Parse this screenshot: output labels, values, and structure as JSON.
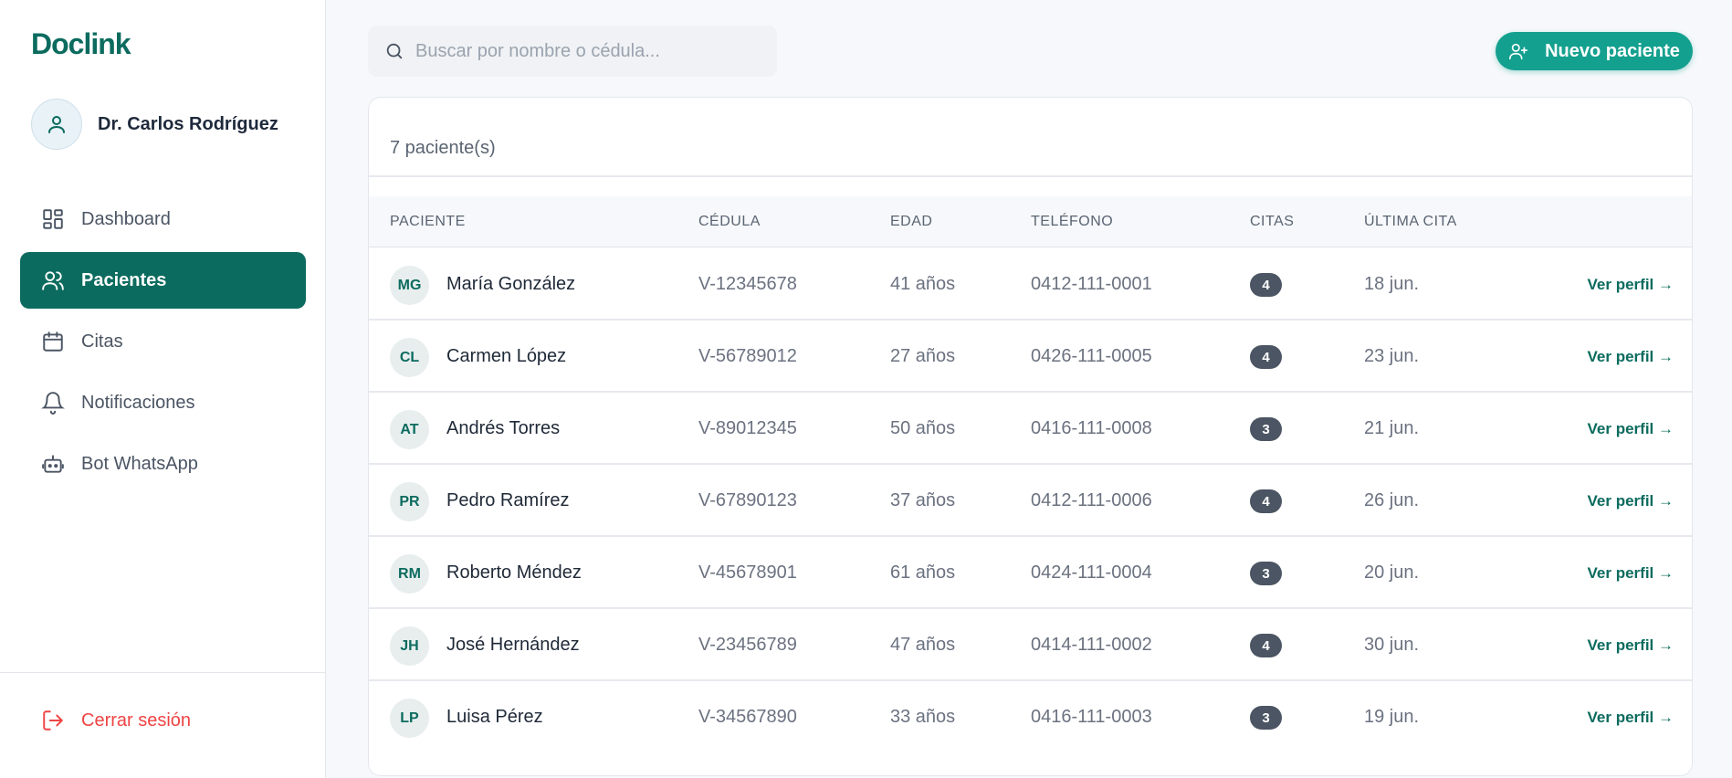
{
  "brand": {
    "name": "Doclink",
    "color": "#0b6b5e",
    "accent": "#14a08f"
  },
  "user": {
    "name": "Dr. Carlos Rodríguez",
    "avatar_icon": "user-icon"
  },
  "nav": [
    {
      "label": "Dashboard",
      "icon": "dashboard-icon",
      "active": false
    },
    {
      "label": "Pacientes",
      "icon": "users-icon",
      "active": true
    },
    {
      "label": "Citas",
      "icon": "calendar-icon",
      "active": false
    },
    {
      "label": "Notificaciones",
      "icon": "bell-icon",
      "active": false
    },
    {
      "label": "Bot WhatsApp",
      "icon": "bot-icon",
      "active": false
    }
  ],
  "logout": {
    "label": "Cerrar sesión",
    "icon": "logout-icon",
    "color": "#ef4444"
  },
  "search": {
    "placeholder": "Buscar por nombre o cédula...",
    "value": ""
  },
  "new_patient": {
    "label": "Nuevo paciente",
    "icon": "user-plus-icon"
  },
  "patients_table": {
    "count_label": "7 paciente(s)",
    "columns": [
      "PACIENTE",
      "CÉDULA",
      "EDAD",
      "TELÉFONO",
      "CITAS",
      "ÚLTIMA CITA"
    ],
    "action_label": "Ver perfil →",
    "rows": [
      {
        "initials": "MG",
        "name": "María González",
        "cedula": "V-12345678",
        "edad": "41 años",
        "telefono": "0412-111-0001",
        "citas": "4",
        "ultima": "18 jun."
      },
      {
        "initials": "CL",
        "name": "Carmen López",
        "cedula": "V-56789012",
        "edad": "27 años",
        "telefono": "0426-111-0005",
        "citas": "4",
        "ultima": "23 jun."
      },
      {
        "initials": "AT",
        "name": "Andrés Torres",
        "cedula": "V-89012345",
        "edad": "50 años",
        "telefono": "0416-111-0008",
        "citas": "3",
        "ultima": "21 jun."
      },
      {
        "initials": "PR",
        "name": "Pedro Ramírez",
        "cedula": "V-67890123",
        "edad": "37 años",
        "telefono": "0412-111-0006",
        "citas": "4",
        "ultima": "26 jun."
      },
      {
        "initials": "RM",
        "name": "Roberto Méndez",
        "cedula": "V-45678901",
        "edad": "61 años",
        "telefono": "0424-111-0004",
        "citas": "3",
        "ultima": "20 jun."
      },
      {
        "initials": "JH",
        "name": "José Hernández",
        "cedula": "V-23456789",
        "edad": "47 años",
        "telefono": "0414-111-0002",
        "citas": "4",
        "ultima": "30 jun."
      },
      {
        "initials": "LP",
        "name": "Luisa Pérez",
        "cedula": "V-34567890",
        "edad": "33 años",
        "telefono": "0416-111-0003",
        "citas": "3",
        "ultima": "19 jun."
      }
    ]
  }
}
